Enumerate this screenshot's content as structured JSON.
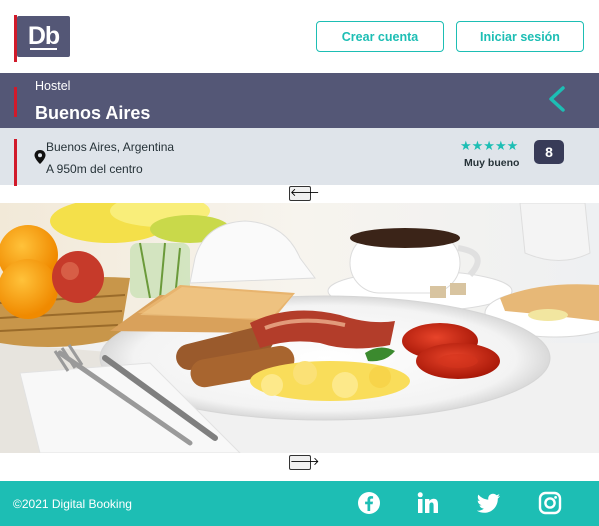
{
  "header": {
    "logo_text": "Db",
    "create_account": "Crear cuenta",
    "login": "Iniciar sesión"
  },
  "hotel": {
    "category": "Hostel",
    "name": "Buenos Aires",
    "address": "Buenos Aires, Argentina",
    "distance": "A 950m del centro",
    "stars": "★★★★★",
    "star_count": 5,
    "rating_label": "Muy bueno",
    "score": "8"
  },
  "gallery": {
    "prev_arrow": "🡐",
    "next_arrow": "🡒"
  },
  "footer": {
    "copyright": "©2021 Digital Booking",
    "social": [
      "facebook-icon",
      "linkedin-icon",
      "twitter-icon",
      "instagram-icon"
    ]
  },
  "colors": {
    "primary": "#1dbeb4",
    "secondary": "#545776",
    "accent": "#d11a2a",
    "score_bg": "#383b58",
    "location_bg": "#dfe4ea"
  }
}
